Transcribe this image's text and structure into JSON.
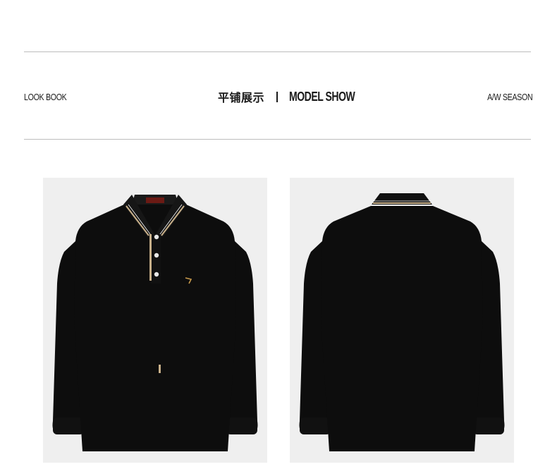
{
  "header": {
    "left_label": "LOOK BOOK",
    "cn_title": "平铺展示",
    "en_title": "MODEL SHOW",
    "right_label": "A/W SEASON"
  },
  "images": {
    "front": "black-polo-front",
    "back": "black-polo-back"
  },
  "colors": {
    "background": "#ffffff",
    "rule": "#bdbdbd",
    "photo_background": "#efefef",
    "garment": "#0d0d0d",
    "collar_stripe": "#c8b08a"
  }
}
